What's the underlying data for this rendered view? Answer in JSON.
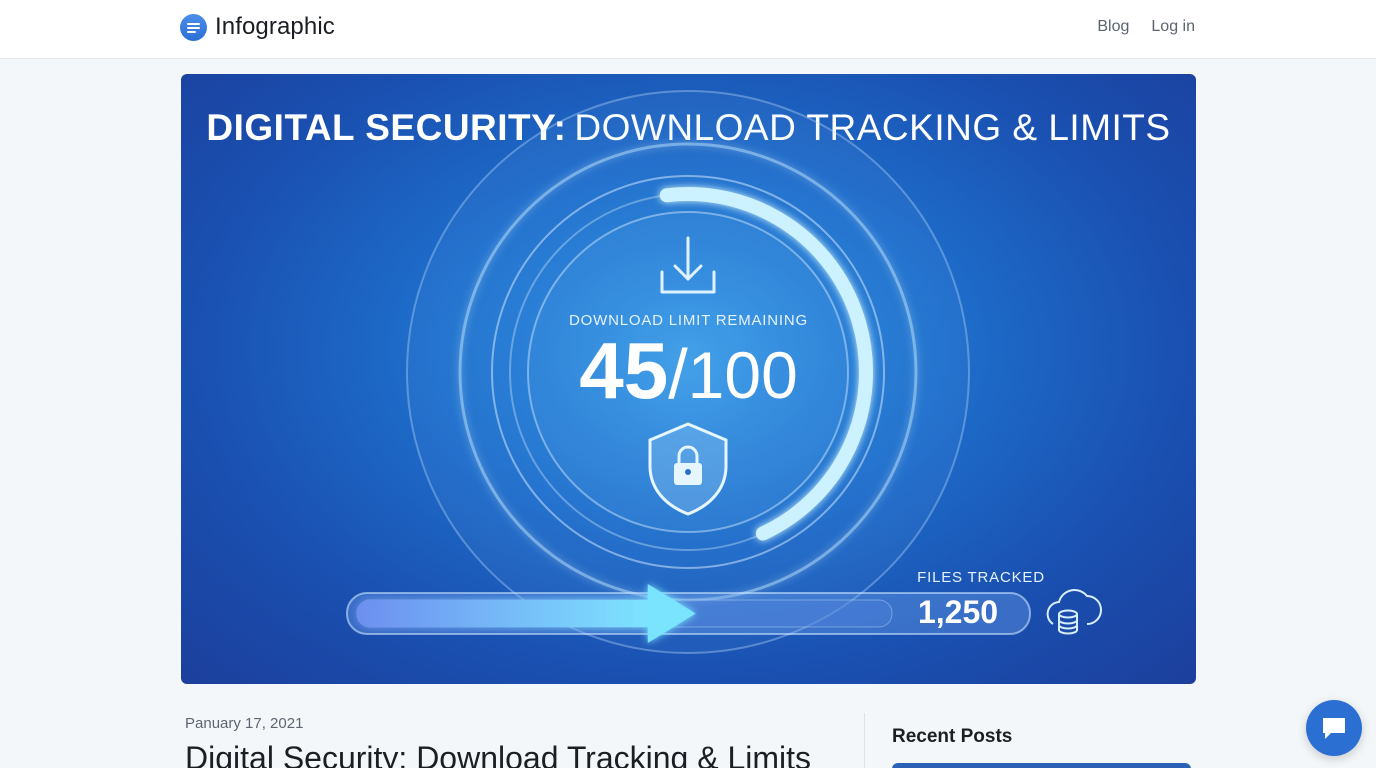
{
  "header": {
    "brand": "Infographic",
    "nav": [
      {
        "label": "Blog"
      },
      {
        "label": "Log in"
      }
    ]
  },
  "hero": {
    "title_strong": "DIGITAL SECURITY:",
    "title_light": "DOWNLOAD TRACKING & LIMITS",
    "gauge_label": "DOWNLOAD LIMIT REMAINING",
    "gauge_value": "45",
    "gauge_separator": "/",
    "gauge_total": "100",
    "gauge_fraction": 0.45,
    "files_label": "FILES TRACKED",
    "files_value": "1,250",
    "icons": [
      "download-icon",
      "shield-lock-icon",
      "arrow-icon",
      "cloud-database-icon"
    ],
    "colors": {
      "accent": "#6fd3ff",
      "background": "#1e6fcc"
    }
  },
  "post": {
    "date": "Panuary 17, 2021",
    "title": "Digital Security: Download Tracking & Limits"
  },
  "sidebar": {
    "recent_title": "Recent Posts"
  },
  "chat": {
    "icon": "chat-icon",
    "color": "#2a6fd1"
  }
}
